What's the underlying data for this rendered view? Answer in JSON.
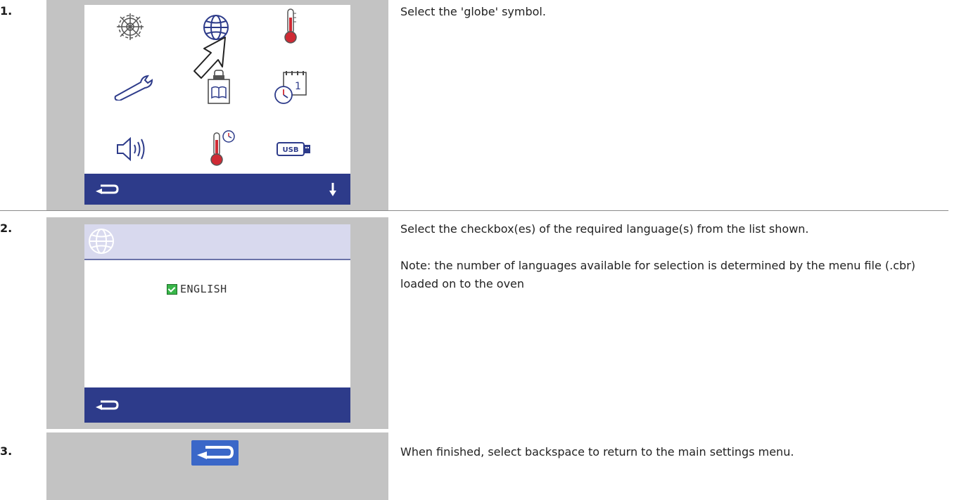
{
  "steps": [
    {
      "number": "1.",
      "text": "Select the 'globe' symbol."
    },
    {
      "number": "2.",
      "text": "Select the checkbox(es) of the required language(s) from the list shown.",
      "note": "Note: the number of languages available for selection is determined by the menu file (.cbr) loaded on to the oven"
    },
    {
      "number": "3.",
      "text": "When finished, select backspace to return to the main settings menu."
    }
  ],
  "language_screen": {
    "language": "ENGLISH",
    "checked": true
  },
  "usb_label": "USB",
  "calendar_day": "1",
  "icons": [
    "wheel-icon",
    "globe-icon",
    "thermometer-icon",
    "wrench-icon",
    "recipe-book-icon",
    "clock-calendar-icon",
    "speaker-icon",
    "temp-timer-icon",
    "usb-icon",
    "back-arrow-icon",
    "down-arrow-icon",
    "pointer-cursor-icon"
  ],
  "colors": {
    "panel_gray": "#c3c3c3",
    "bar_blue": "#2d3b8a",
    "header_lavender": "#d8d9ee",
    "check_green": "#39b64a",
    "icon_red": "#cf2a34"
  }
}
